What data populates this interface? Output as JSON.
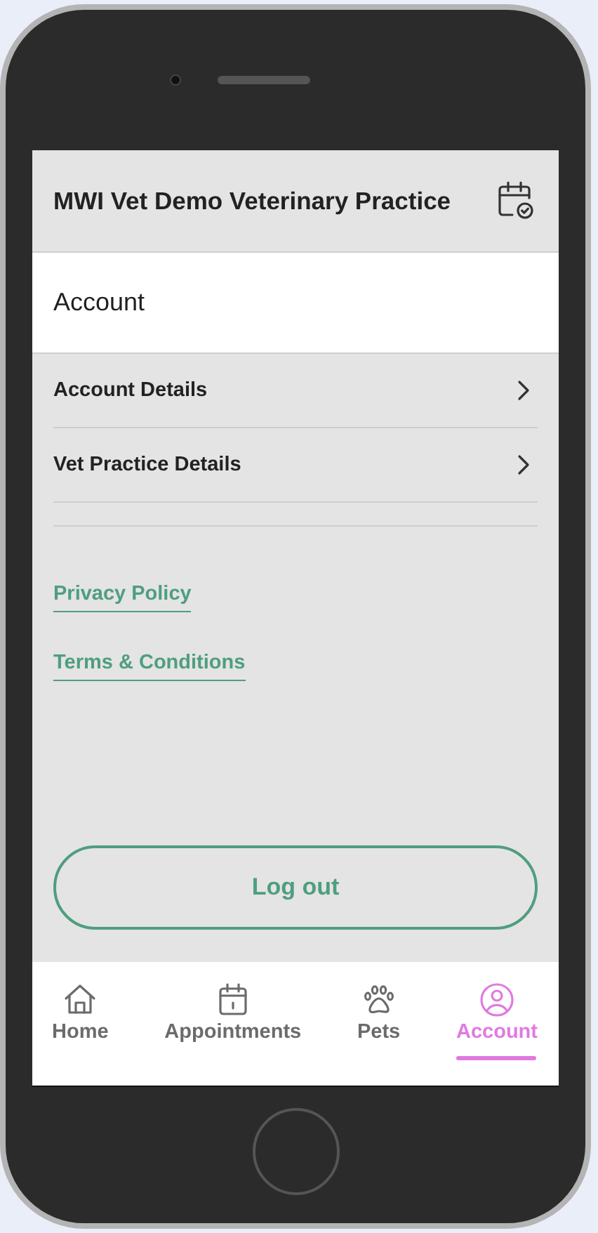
{
  "header": {
    "title": "MWI Vet Demo Veterinary Practice"
  },
  "section": {
    "title": "Account"
  },
  "menu": [
    {
      "label": "Account Details"
    },
    {
      "label": "Vet Practice Details"
    }
  ],
  "links": [
    {
      "label": "Privacy Policy"
    },
    {
      "label": "Terms & Conditions"
    }
  ],
  "logout": {
    "label": "Log out"
  },
  "tabs": [
    {
      "kind": "home",
      "label": "Home",
      "selected": false
    },
    {
      "kind": "appointments",
      "label": "Appointments",
      "selected": false
    },
    {
      "kind": "pets",
      "label": "Pets",
      "selected": false
    },
    {
      "kind": "account",
      "label": "Account",
      "selected": true
    }
  ]
}
